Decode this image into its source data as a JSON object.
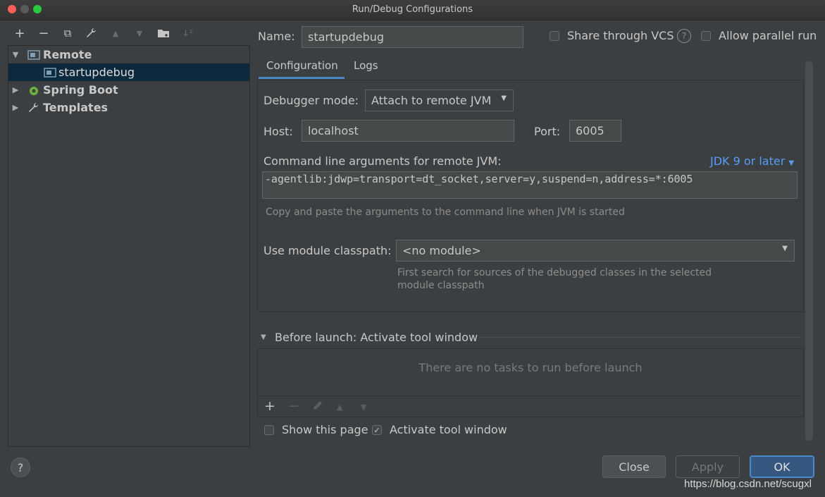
{
  "window": {
    "title": "Run/Debug Configurations"
  },
  "toolbar": {
    "add": "+",
    "remove": "−",
    "copy": "⧉",
    "edit": "🔧",
    "up": "▲",
    "down": "▼",
    "folder": "📁",
    "sort": "↓²"
  },
  "tree": {
    "remote_label": "Remote",
    "child_label": "startupdebug",
    "spring_label": "Spring Boot",
    "templates_label": "Templates"
  },
  "header": {
    "name_label": "Name:",
    "name_value": "startupdebug",
    "share_label": "Share through VCS",
    "parallel_label": "Allow parallel run"
  },
  "tabs": {
    "configuration": "Configuration",
    "logs": "Logs"
  },
  "config": {
    "debugger_mode_label": "Debugger mode:",
    "debugger_mode_value": "Attach to remote JVM",
    "host_label": "Host:",
    "host_value": "localhost",
    "port_label": "Port:",
    "port_value": "6005",
    "cmd_label": "Command line arguments for remote JVM:",
    "jdk_link": "JDK 9 or later",
    "cmd_value": "-agentlib:jdwp=transport=dt_socket,server=y,suspend=n,address=*:6005",
    "cmd_hint": "Copy and paste the arguments to the command line when JVM is started",
    "module_label": "Use module classpath:",
    "module_value": "<no module>",
    "module_hint_line1": "First search for sources of the debugged classes in the selected",
    "module_hint_line2": "module classpath"
  },
  "before_launch": {
    "title": "Before launch: Activate tool window",
    "empty": "There are no tasks to run before launch"
  },
  "footer": {
    "show_page_label": "Show this page",
    "activate_label": "Activate tool window",
    "close_label": "Close",
    "apply_label": "Apply",
    "ok_label": "OK",
    "help_label": "?"
  },
  "watermark": "https://blog.csdn.net/scugxl",
  "colors": {
    "accent": "#365880",
    "link": "#589df6",
    "selection": "#0d293e"
  }
}
